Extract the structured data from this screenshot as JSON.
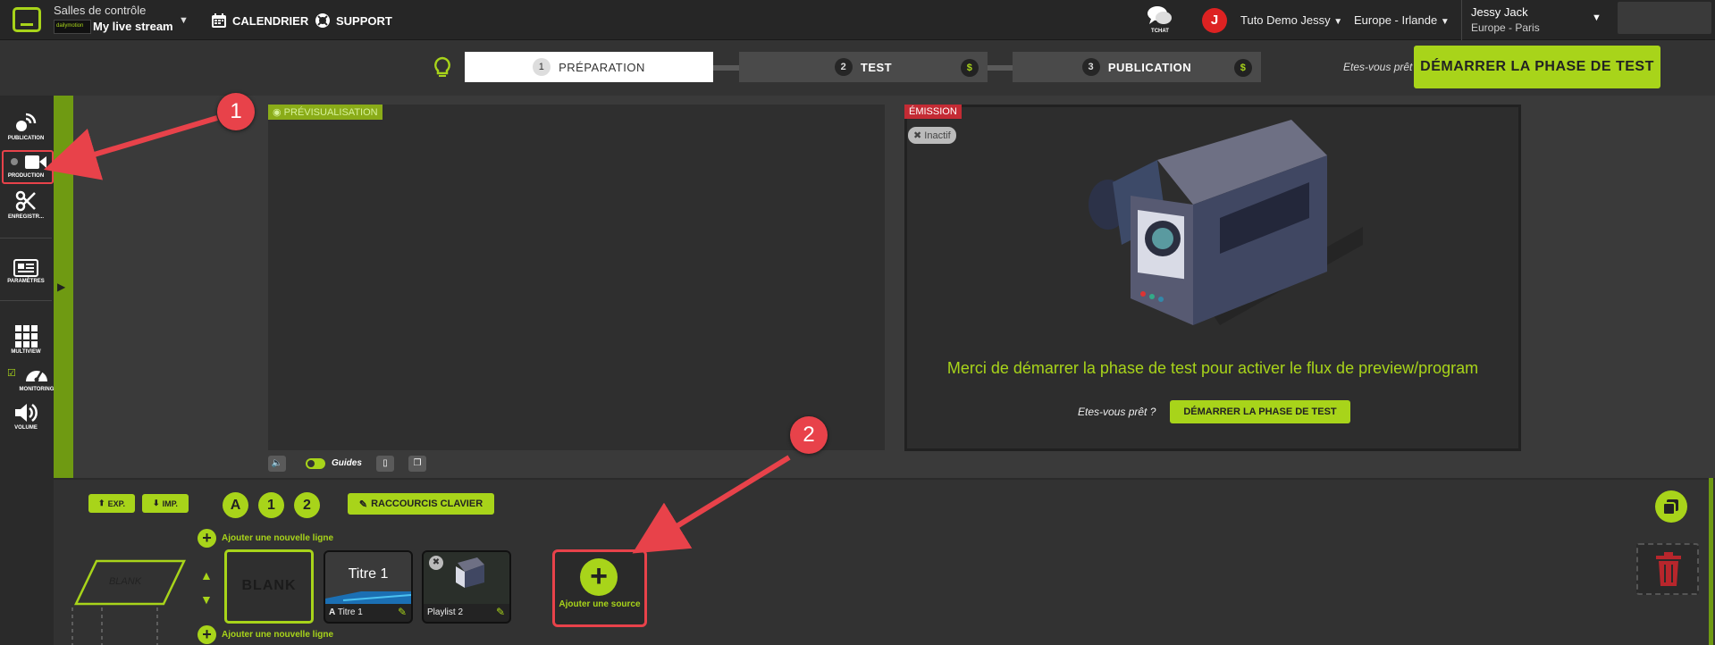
{
  "header": {
    "room_label": "Salles de contrôle",
    "room_logo_text": "dailymotion",
    "room_name": "My live stream",
    "nav": [
      {
        "label": "CALENDRIER",
        "icon": "calendar-icon"
      },
      {
        "label": "SUPPORT",
        "icon": "lifebuoy-icon"
      }
    ],
    "tchat_label": "TCHAT",
    "avatar_initial": "J",
    "account": "Tuto Demo Jessy",
    "region": "Europe - Irlande",
    "user_name": "Jessy Jack",
    "user_timezone": "Europe - Paris"
  },
  "steps": [
    {
      "num": "1",
      "label": "PRÉPARATION",
      "active": true
    },
    {
      "num": "2",
      "label": "TEST",
      "paid": "$"
    },
    {
      "num": "3",
      "label": "PUBLICATION",
      "paid": "$"
    }
  ],
  "ready_text": "Etes-vous prêt ?",
  "start_test_label": "DÉMARRER LA PHASE DE TEST",
  "sidebar": [
    {
      "label": "PUBLICATION",
      "icon": "broadcast-icon"
    },
    {
      "label": "PRODUCTION",
      "icon": "video-camera-icon"
    },
    {
      "label": "ENREGISTR...",
      "icon": "scissors-icon"
    },
    {
      "label": "PARAMÈTRES",
      "icon": "newspaper-icon"
    },
    {
      "label": "MULTIVIEW",
      "icon": "grid-icon"
    },
    {
      "label": "MONITORING",
      "icon": "gauge-icon"
    },
    {
      "label": "VOLUME",
      "icon": "speaker-icon"
    }
  ],
  "preview": {
    "tag": "PRÉVISUALISATION",
    "guides_label": "Guides"
  },
  "emission": {
    "tag": "ÉMISSION",
    "status": "Inactif",
    "message": "Merci de démarrer la phase de test pour activer le flux de preview/program",
    "ready_text": "Etes-vous prêt ?",
    "button": "DÉMARRER LA PHASE DE TEST"
  },
  "bottom": {
    "export_label": "EXP.",
    "import_label": "IMP.",
    "layers": [
      "A",
      "1",
      "2"
    ],
    "shortcuts_label": "RACCOURCIS CLAVIER",
    "add_line_label": "Ajouter une nouvelle ligne",
    "blank_label": "BLANK",
    "tiles": [
      {
        "title": "Titre 1",
        "label": "Titre 1"
      },
      {
        "label": "Playlist 2"
      }
    ],
    "add_source_label": "Ajouter une source"
  },
  "annotations": [
    "1",
    "2"
  ],
  "colors": {
    "accent": "#a8d41a",
    "alert": "#e8424a",
    "bg": "#3a3a3a"
  }
}
